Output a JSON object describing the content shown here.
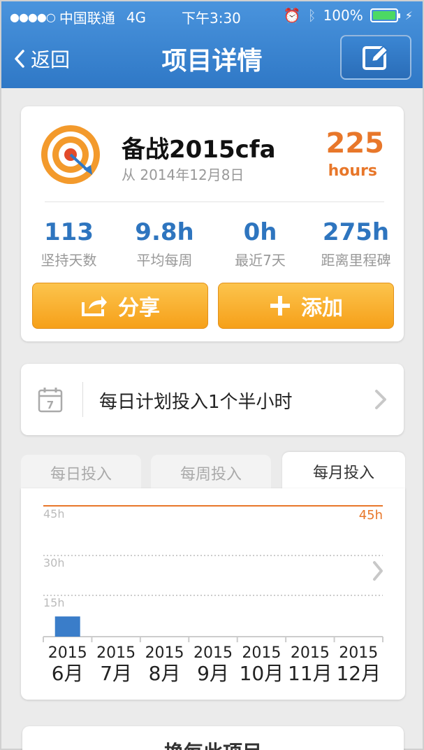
{
  "status_bar": {
    "carrier": "中国联通",
    "network": "4G",
    "time": "下午3:30",
    "battery": "100%"
  },
  "nav": {
    "back_label": "返回",
    "title": "项目详情"
  },
  "summary": {
    "project_name": "备战2015cfa",
    "since": "从 2014年12月8日",
    "total_hours": "225",
    "hours_unit": "hours",
    "stats": [
      {
        "value": "113",
        "label": "坚持天数"
      },
      {
        "value": "9.8h",
        "label": "平均每周"
      },
      {
        "value": "0h",
        "label": "最近7天"
      },
      {
        "value": "275h",
        "label": "距离里程碑"
      }
    ],
    "share_label": "分享",
    "add_label": "添加"
  },
  "plan": {
    "text": "每日计划投入1个半小时",
    "calendar_day": "7"
  },
  "tabs": [
    {
      "label": "每日投入",
      "active": false
    },
    {
      "label": "每周投入",
      "active": false
    },
    {
      "label": "每月投入",
      "active": true
    }
  ],
  "chart_data": {
    "type": "bar",
    "categories": [
      "6月",
      "7月",
      "8月",
      "9月",
      "10月",
      "11月",
      "12月"
    ],
    "category_years": [
      "2015",
      "2015",
      "2015",
      "2015",
      "2015",
      "2015",
      "2015"
    ],
    "values": [
      8,
      0,
      0,
      0,
      0,
      0,
      0
    ],
    "y_ticks": [
      "15h",
      "30h",
      "45h"
    ],
    "ylim": [
      0,
      50
    ],
    "target_line": {
      "value": 45,
      "label": "45h"
    },
    "grid": true,
    "colors": {
      "bar": "#3a7dc9",
      "target": "#e8772a"
    }
  },
  "next_card": {
    "text": "换每此项目"
  },
  "colors": {
    "nav_blue": "#2f78c6",
    "accent_orange": "#e8772a",
    "stat_blue": "#2e75bf"
  }
}
